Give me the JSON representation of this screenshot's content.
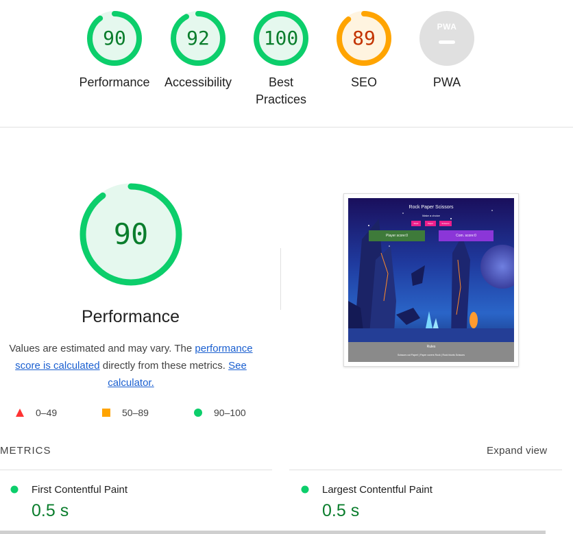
{
  "categories": [
    {
      "label": "Performance",
      "score": "90",
      "status": "pass"
    },
    {
      "label": "Accessibility",
      "score": "92",
      "status": "pass"
    },
    {
      "label": "Best Practices",
      "score": "100",
      "status": "pass"
    },
    {
      "label": "SEO",
      "score": "89",
      "status": "average"
    },
    {
      "label": "PWA",
      "score": "",
      "status": "na",
      "badge_text": "PWA"
    }
  ],
  "performance": {
    "score": "90",
    "title": "Performance",
    "desc_prefix": "Values are estimated and may vary. The ",
    "desc_link1": "performance score is calculated",
    "desc_middle": " directly from these metrics. ",
    "desc_link2": "See calculator."
  },
  "legend": [
    {
      "range": "0–49",
      "shape": "triangle",
      "color": "#ff3333"
    },
    {
      "range": "50–89",
      "shape": "square",
      "color": "#ffa400"
    },
    {
      "range": "90–100",
      "shape": "circle",
      "color": "#0cce6b"
    }
  ],
  "screenshot": {
    "app_title": "Rock Paper Scissors",
    "subtitle": "Make a choice",
    "buttons": [
      "Rock",
      "Paper",
      "Scissors"
    ],
    "player_score": "Player score:0",
    "comp_score": "Com. score:0",
    "rules_title": "Rules",
    "rules_text": "Scissors cut Paper! | Paper covers Rock | Rock blunts Scissors"
  },
  "metrics": {
    "title": "METRICS",
    "expand_label": "Expand view",
    "items": [
      {
        "name": "First Contentful Paint",
        "value": "0.5 s"
      },
      {
        "name": "Largest Contentful Paint",
        "value": "0.5 s"
      }
    ]
  },
  "colors": {
    "pass": "#0cce6b",
    "pass_fill": "#e5f8ee",
    "pass_text": "#0a7d2c",
    "average": "#ffa400",
    "average_fill": "#fff4e0",
    "average_text": "#c33300",
    "na": "#e0e0e0"
  }
}
